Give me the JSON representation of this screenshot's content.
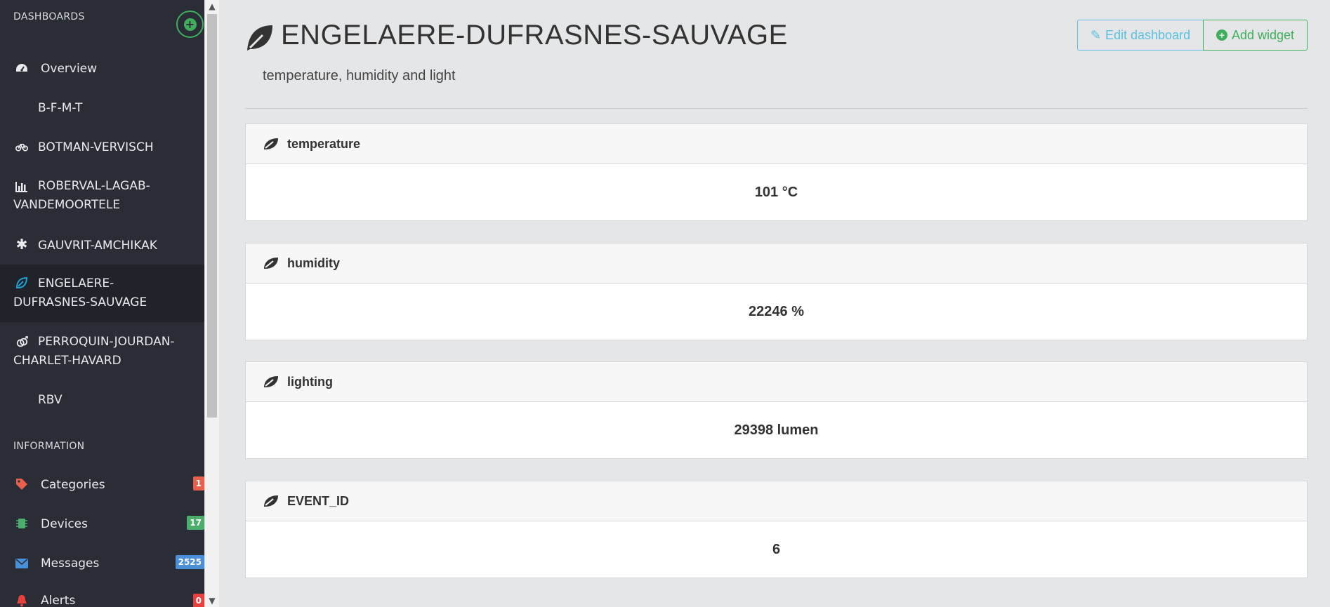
{
  "sidebar": {
    "dashboards_header": "DASHBOARDS",
    "add_dashboard_icon": "plus-circle-icon",
    "items": [
      {
        "label": "Overview",
        "icon": "dashboard-icon"
      },
      {
        "label": "B-F-M-T",
        "icon": ""
      },
      {
        "label": "BOTMAN-VERVISCH",
        "icon": "bicycle-icon"
      },
      {
        "label": "ROBERVAL-LAGAB-VANDEMOORTELE",
        "icon": "bar-chart-icon"
      },
      {
        "label": "GAUVRIT-AMCHIKAK",
        "icon": "asterisk-icon"
      },
      {
        "label": "ENGELAERE-DUFRASNES-SAUVAGE",
        "icon": "leaf-icon",
        "active": true
      },
      {
        "label": "PERROQUIN-JOURDAN-CHARLET-HAVARD",
        "icon": "gender-icon"
      },
      {
        "label": "RBV",
        "icon": ""
      }
    ],
    "information_header": "INFORMATION",
    "info_items": [
      {
        "label": "Categories",
        "icon": "tag-icon",
        "badge": "1",
        "badge_color": "#e8604c"
      },
      {
        "label": "Devices",
        "icon": "chip-icon",
        "badge": "17",
        "badge_color": "#4cae6c"
      },
      {
        "label": "Messages",
        "icon": "envelope-icon",
        "badge": "2525",
        "badge_color": "#4a90d9"
      },
      {
        "label": "Alerts",
        "icon": "bell-icon",
        "badge": "0",
        "badge_color": "#e8403c"
      }
    ]
  },
  "header": {
    "title": "ENGELAERE-DUFRASNES-SAUVAGE",
    "subtitle": "temperature, humidity and light",
    "edit_label": "Edit dashboard",
    "add_label": "Add widget"
  },
  "widgets": [
    {
      "title": "temperature",
      "value": "101 °C"
    },
    {
      "title": "humidity",
      "value": "22246 %"
    },
    {
      "title": "lighting",
      "value": "29398 lumen"
    },
    {
      "title": "EVENT_ID",
      "value": "6"
    }
  ],
  "colors": {
    "sidebar_bg": "#2a2d35",
    "accent_green": "#3fae5c",
    "accent_blue": "#5bc0de",
    "active_icon": "#1fa3d6"
  }
}
